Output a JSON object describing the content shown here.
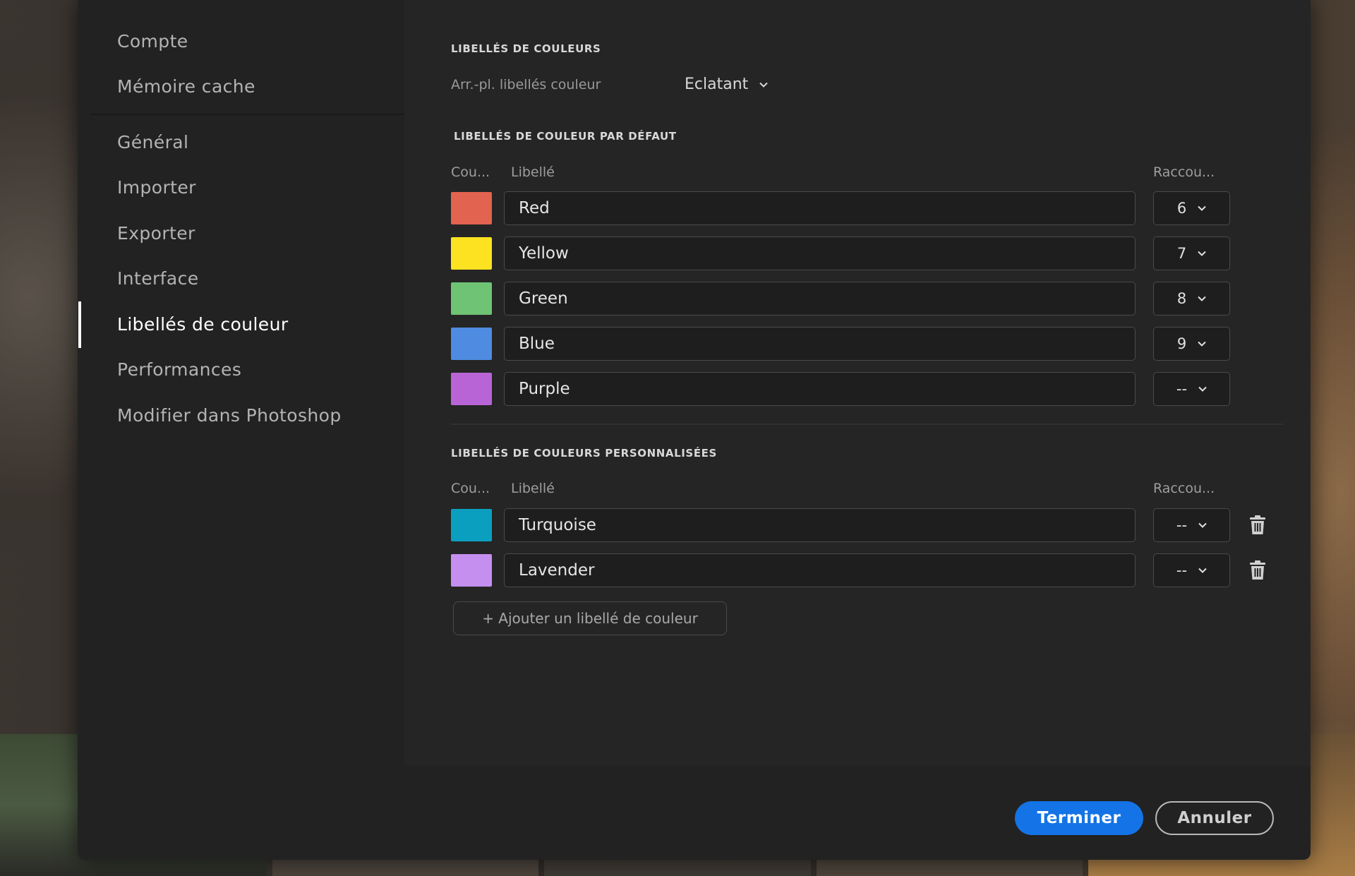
{
  "sidebar": {
    "items": [
      {
        "label": "Compte"
      },
      {
        "label": "Mémoire cache"
      },
      {
        "label": "Général"
      },
      {
        "label": "Importer"
      },
      {
        "label": "Exporter"
      },
      {
        "label": "Interface"
      },
      {
        "label": "Libellés de couleur"
      },
      {
        "label": "Performances"
      },
      {
        "label": "Modifier dans Photoshop"
      }
    ],
    "active": "Libellés de couleur"
  },
  "color_labels": {
    "title": "LIBELLÉS DE COULEURS",
    "background_label": "Arr.-pl. libellés couleur",
    "background_value": "Eclatant"
  },
  "default_labels": {
    "title": "LIBELLÉS DE COULEUR PAR DÉFAUT",
    "col_color": "Cou...",
    "col_label": "Libellé",
    "col_shortcut": "Raccou...",
    "rows": [
      {
        "color": "#e2634f",
        "label": "Red",
        "shortcut": "6"
      },
      {
        "color": "#fce221",
        "label": "Yellow",
        "shortcut": "7"
      },
      {
        "color": "#6fc374",
        "label": "Green",
        "shortcut": "8"
      },
      {
        "color": "#4f8be0",
        "label": "Blue",
        "shortcut": "9"
      },
      {
        "color": "#b864d6",
        "label": "Purple",
        "shortcut": "--"
      }
    ]
  },
  "custom_labels": {
    "title": "LIBELLÉS DE COULEURS PERSONNALISÉES",
    "col_color": "Cou...",
    "col_label": "Libellé",
    "col_shortcut": "Raccou...",
    "rows": [
      {
        "color": "#0b9fbf",
        "label": "Turquoise",
        "shortcut": "--"
      },
      {
        "color": "#c58ff0",
        "label": "Lavender",
        "shortcut": "--"
      }
    ],
    "add_label": "+ Ajouter un libellé de couleur"
  },
  "footer": {
    "primary_label": "Terminer",
    "secondary_label": "Annuler"
  },
  "icons": {
    "chevron": "chevron-down-icon",
    "delete": "trash-icon"
  }
}
